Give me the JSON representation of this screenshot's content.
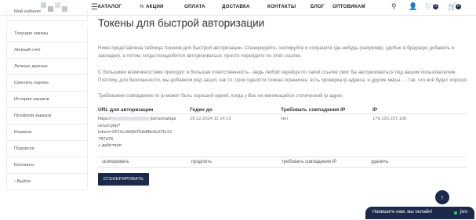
{
  "header": {
    "nav": [
      "КАТАЛОГ",
      "АКЦИИ",
      "ОПЛАТА",
      "ДОСТАВКА",
      "КОНТАКТЫ",
      "БЛОГ",
      "ОПТОВИКАМ"
    ],
    "wishlist_count": "0",
    "cart_count": "0"
  },
  "sidebar": {
    "items": [
      "Мой кабинет",
      "Текущие заказы",
      "Личный счет",
      "Личные данные",
      "Сменить пароль",
      "История заказов",
      "Профили заказов",
      "Корзина",
      "Подписки",
      "Контакты",
      "Выйти"
    ]
  },
  "main": {
    "title": "Токены для быстрой авторизации",
    "intro": "Ниже представлена таблица токенов для быстрой авторизации. Сгенерируйте, скопируйте и сохраните где-нибудь (например, удобно в браузере добавить в закладки), а потом, когда понадобится авторизоваться, просто перейдите по этой ссылке.",
    "warning_1": "С большими возможностями приходит и большая ответственность - ведь любой перейдя по такой ссылке смог бы авторизоваться под вашим пользователем. Поэтому, для безопасности, мы добавили ряд защит, как то: срок годности токена ограничен, есть проверка ip адреса, и другие меры... - так, что всё будет хорошо.",
    "warning_2": "Требование совпадения по ip может быть хорошей идеей, когда у Вас не меняющийся статический ip адрес",
    "table": {
      "headers": [
        "URL для авторизации",
        "Годен до",
        "Требовать совпадения IP",
        "IP"
      ],
      "row": {
        "url_line1": "https://",
        "url_line1b": "/personal/qui",
        "url_line2": "ck/url.php?",
        "url_line3": "token=2473cc8d0d7b8df8e9e37fc13",
        "url_line4": "7ff7d76",
        "actions_toggle": "+ действия",
        "valid_until": "29.12.2024 11:14:13",
        "require_ip": "Нет",
        "ip": "176.120.237.105"
      },
      "actions": [
        "скопировать",
        "продлить",
        "требовать совпадения IP",
        "удалить"
      ]
    },
    "generate_button": "СГЕНЕРИРОВАТЬ"
  },
  "chat": {
    "message": "Напишите нам, мы онлайн!",
    "brand": "jivo"
  },
  "colors": {
    "brand_dark": "#1b2a4a",
    "online": "#2ecc71"
  }
}
